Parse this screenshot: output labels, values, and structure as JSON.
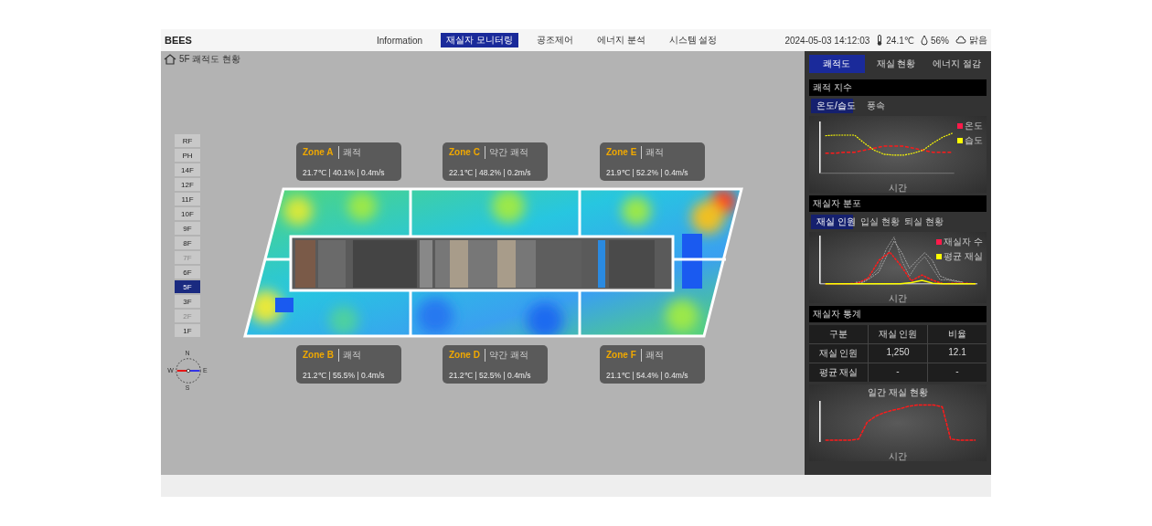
{
  "header": {
    "logo": "BEES",
    "nav": [
      {
        "label": "Information",
        "selected": false
      },
      {
        "label": "재실자 모니터링",
        "selected": true
      },
      {
        "label": "공조제어",
        "selected": false
      },
      {
        "label": "에너지 분석",
        "selected": false
      },
      {
        "label": "시스템 설정",
        "selected": false
      }
    ],
    "datetime": "2024-05-03 14:12:03",
    "weather": [
      {
        "kind": "temperature",
        "value": "24.1℃"
      },
      {
        "kind": "humidity",
        "value": "56%"
      },
      {
        "kind": "sky",
        "value": "맑음"
      }
    ]
  },
  "breadcrumb": "5F 쾌적도 현황",
  "floors": [
    {
      "label": "RF",
      "selected": false,
      "disabled": false
    },
    {
      "label": "PH",
      "selected": false,
      "disabled": false
    },
    {
      "label": "14F",
      "selected": false,
      "disabled": false
    },
    {
      "label": "12F",
      "selected": false,
      "disabled": false
    },
    {
      "label": "11F",
      "selected": false,
      "disabled": false
    },
    {
      "label": "10F",
      "selected": false,
      "disabled": false
    },
    {
      "label": "9F",
      "selected": false,
      "disabled": false
    },
    {
      "label": "8F",
      "selected": false,
      "disabled": false
    },
    {
      "label": "7F",
      "selected": false,
      "disabled": true
    },
    {
      "label": "6F",
      "selected": false,
      "disabled": false
    },
    {
      "label": "5F",
      "selected": true,
      "disabled": false
    },
    {
      "label": "3F",
      "selected": false,
      "disabled": false
    },
    {
      "label": "2F",
      "selected": false,
      "disabled": true
    },
    {
      "label": "1F",
      "selected": false,
      "disabled": false
    }
  ],
  "compass": {
    "north": "N",
    "south": "S",
    "west": "W",
    "east": "E"
  },
  "zones": [
    {
      "name": "Zone A",
      "status": "쾌적",
      "readings": "21.7℃ | 40.1% | 0.4m/s"
    },
    {
      "name": "Zone C",
      "status": "약간 쾌적",
      "readings": "22.1℃ | 48.2% | 0.2m/s"
    },
    {
      "name": "Zone E",
      "status": "쾌적",
      "readings": "21.9℃ | 52.2% | 0.4m/s"
    },
    {
      "name": "Zone B",
      "status": "쾌적",
      "readings": "21.2℃ | 55.5% | 0.4m/s"
    },
    {
      "name": "Zone D",
      "status": "약간 쾌적",
      "readings": "21.2℃ | 52.5% | 0.4m/s"
    },
    {
      "name": "Zone F",
      "status": "쾌적",
      "readings": "21.1℃ | 54.4% | 0.4m/s"
    }
  ],
  "panel": {
    "tabs": [
      {
        "label": "쾌적도",
        "selected": true
      },
      {
        "label": "재실 현황",
        "selected": false
      },
      {
        "label": "에너지 절감",
        "selected": false
      }
    ],
    "comfort": {
      "title": "쾌적 지수",
      "tabs": [
        {
          "label": "온도/습도",
          "selected": true
        },
        {
          "label": "풍속",
          "selected": false
        }
      ],
      "legend": [
        {
          "label": "온도",
          "color": "#ff1a4a"
        },
        {
          "label": "습도",
          "color": "#ffff00"
        }
      ],
      "xlabel": "시간"
    },
    "occupancy": {
      "title": "재실자 분포",
      "tabs": [
        {
          "label": "재실 인원",
          "selected": true
        },
        {
          "label": "입실 현황",
          "selected": false
        },
        {
          "label": "퇴실 현황",
          "selected": false
        }
      ],
      "legend": [
        {
          "label": "재실자 수",
          "color": "#ff1a4a"
        },
        {
          "label": "평균 재실",
          "color": "#ffff00"
        }
      ],
      "xlabel": "시간"
    },
    "stats": {
      "title": "재실자 통계",
      "columns": [
        "구분",
        "재실 인원",
        "비율"
      ],
      "rows": [
        [
          "재실 인원",
          "1,250",
          "12.1"
        ],
        [
          "평균 재실",
          "-",
          "-"
        ]
      ]
    },
    "daily": {
      "title": "일간 재실 현황",
      "xlabel": "시간"
    }
  }
}
